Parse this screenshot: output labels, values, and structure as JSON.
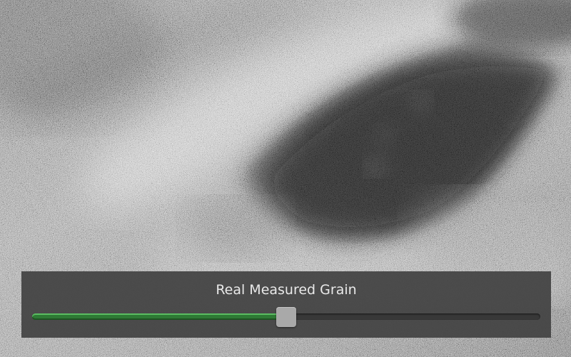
{
  "overlay": {
    "title": "Real Measured Grain"
  },
  "grain_slider": {
    "value_fraction": 0.5,
    "fill_color": "#2e7a35",
    "track_color": "#383838",
    "thumb_color": "#a9a9a9"
  },
  "background_image": {
    "icon": "grainy-eye-photo"
  }
}
